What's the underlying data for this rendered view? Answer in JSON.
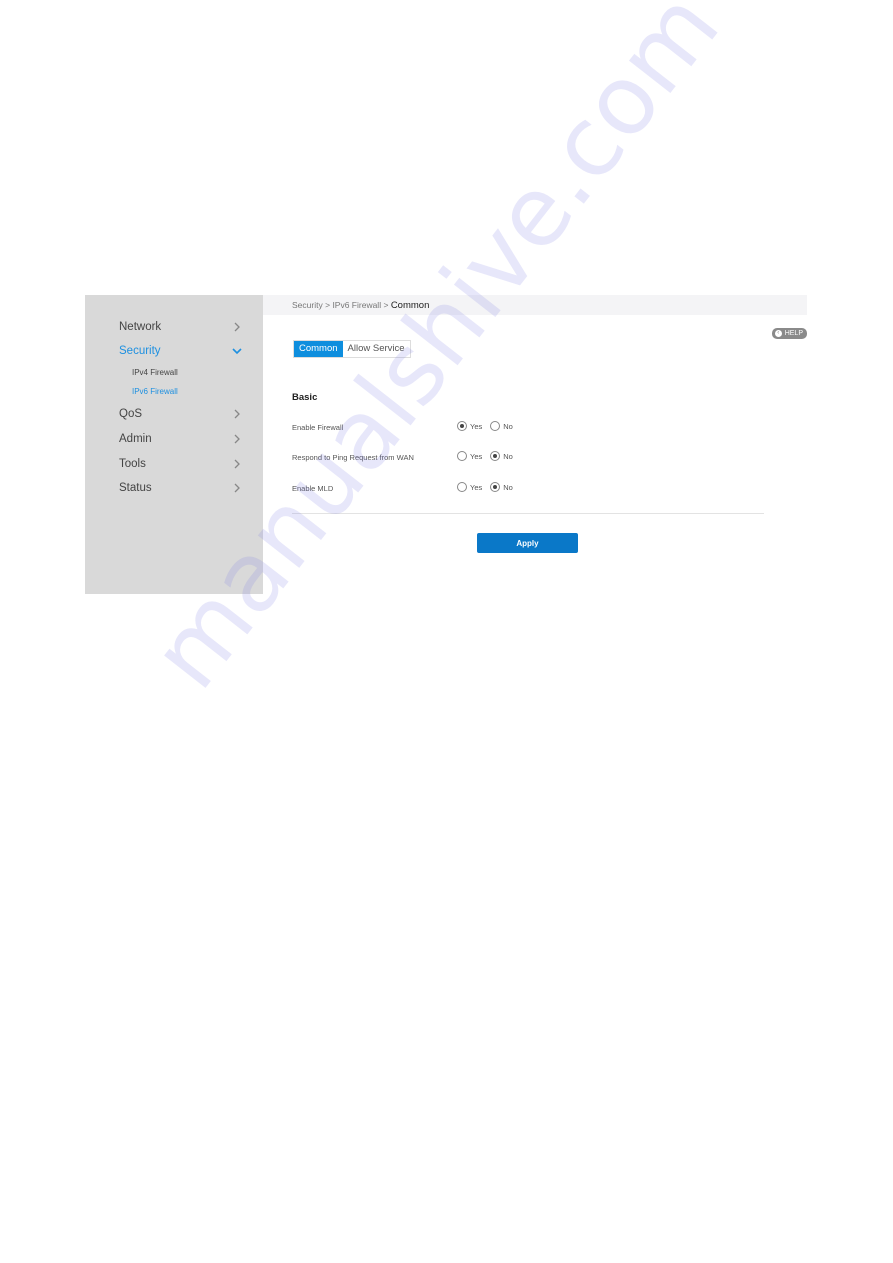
{
  "sidebar": {
    "items": [
      {
        "label": "Network",
        "icon": "chevron-right-icon",
        "active": false
      },
      {
        "label": "Security",
        "icon": "chevron-down-icon",
        "active": true,
        "children": [
          {
            "label": "IPv4 Firewall",
            "active": false
          },
          {
            "label": "IPv6 Firewall",
            "active": true
          }
        ]
      },
      {
        "label": "QoS",
        "icon": "chevron-right-icon",
        "active": false
      },
      {
        "label": "Admin",
        "icon": "chevron-right-icon",
        "active": false
      },
      {
        "label": "Tools",
        "icon": "chevron-right-icon",
        "active": false
      },
      {
        "label": "Status",
        "icon": "chevron-right-icon",
        "active": false
      }
    ]
  },
  "breadcrumb": {
    "items": [
      "Security",
      "IPv6 Firewall",
      "Common"
    ],
    "separator": ">"
  },
  "help": {
    "label": "HELP",
    "icon": "help-back-icon"
  },
  "tabs": [
    {
      "label": "Common",
      "active": true
    },
    {
      "label": "Allow Service",
      "active": false
    }
  ],
  "section": {
    "title": "Basic"
  },
  "settings": [
    {
      "label": "Enable Firewall",
      "options": [
        "Yes",
        "No"
      ],
      "selected": "Yes"
    },
    {
      "label": "Respond to Ping Request from WAN",
      "options": [
        "Yes",
        "No"
      ],
      "selected": "No"
    },
    {
      "label": "Enable MLD",
      "options": [
        "Yes",
        "No"
      ],
      "selected": "No"
    }
  ],
  "apply_label": "Apply",
  "watermark": "manualshive.com",
  "colors": {
    "accent": "#0e8ede",
    "apply": "#0a78c8",
    "sidebar_bg": "#d9d9d9",
    "active_nav": "#1e90e0"
  }
}
